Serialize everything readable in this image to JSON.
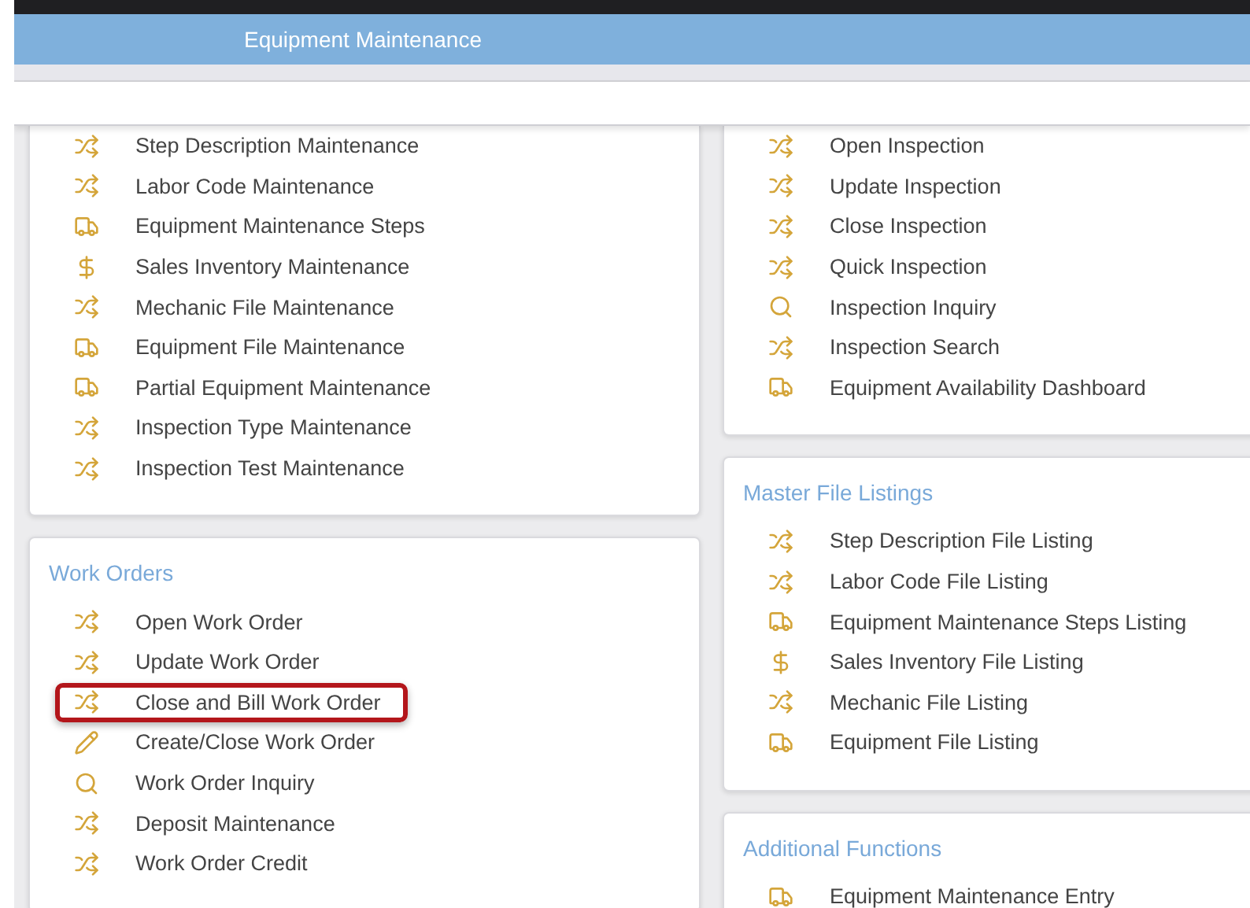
{
  "header": {
    "title": "Equipment Maintenance"
  },
  "columns": [
    {
      "cards": [
        {
          "items": [
            {
              "kind": "shuffle",
              "label": "Step Description Maintenance",
              "highlighted": false
            },
            {
              "kind": "shuffle",
              "label": "Labor Code Maintenance",
              "highlighted": false
            },
            {
              "kind": "truck",
              "label": "Equipment Maintenance Steps",
              "highlighted": false
            },
            {
              "kind": "dollar",
              "label": "Sales Inventory Maintenance",
              "highlighted": false
            },
            {
              "kind": "shuffle",
              "label": "Mechanic File Maintenance",
              "highlighted": false
            },
            {
              "kind": "truck",
              "label": "Equipment File Maintenance",
              "highlighted": false
            },
            {
              "kind": "truck",
              "label": "Partial Equipment Maintenance",
              "highlighted": false
            },
            {
              "kind": "shuffle",
              "label": "Inspection Type Maintenance",
              "highlighted": false
            },
            {
              "kind": "shuffle",
              "label": "Inspection Test Maintenance",
              "highlighted": false
            }
          ]
        },
        {
          "title": "Work Orders",
          "items": [
            {
              "kind": "shuffle",
              "label": "Open Work Order",
              "highlighted": false
            },
            {
              "kind": "shuffle",
              "label": "Update Work Order",
              "highlighted": false
            },
            {
              "kind": "shuffle",
              "label": "Close and Bill Work Order",
              "highlighted": true
            },
            {
              "kind": "pencil",
              "label": "Create/Close Work Order",
              "highlighted": false
            },
            {
              "kind": "search",
              "label": "Work Order Inquiry",
              "highlighted": false
            },
            {
              "kind": "shuffle",
              "label": "Deposit Maintenance",
              "highlighted": false
            },
            {
              "kind": "shuffle",
              "label": "Work Order Credit",
              "highlighted": false
            }
          ]
        }
      ]
    },
    {
      "cards": [
        {
          "items": [
            {
              "kind": "shuffle",
              "label": "Open Inspection",
              "highlighted": false
            },
            {
              "kind": "shuffle",
              "label": "Update Inspection",
              "highlighted": false
            },
            {
              "kind": "shuffle",
              "label": "Close Inspection",
              "highlighted": false
            },
            {
              "kind": "shuffle",
              "label": "Quick Inspection",
              "highlighted": false
            },
            {
              "kind": "search",
              "label": "Inspection Inquiry",
              "highlighted": false
            },
            {
              "kind": "shuffle",
              "label": "Inspection Search",
              "highlighted": false
            },
            {
              "kind": "truck",
              "label": "Equipment Availability Dashboard",
              "highlighted": false
            }
          ]
        },
        {
          "title": "Master File Listings",
          "items": [
            {
              "kind": "shuffle",
              "label": "Step Description File Listing",
              "highlighted": false
            },
            {
              "kind": "shuffle",
              "label": "Labor Code File Listing",
              "highlighted": false
            },
            {
              "kind": "truck",
              "label": "Equipment Maintenance Steps Listing",
              "highlighted": false
            },
            {
              "kind": "dollar",
              "label": "Sales Inventory File Listing",
              "highlighted": false
            },
            {
              "kind": "shuffle",
              "label": "Mechanic File Listing",
              "highlighted": false
            },
            {
              "kind": "truck",
              "label": "Equipment File Listing",
              "highlighted": false
            }
          ]
        },
        {
          "title": "Additional Functions",
          "items": [
            {
              "kind": "truck",
              "label": "Equipment Maintenance Entry",
              "highlighted": false
            }
          ]
        }
      ]
    }
  ]
}
